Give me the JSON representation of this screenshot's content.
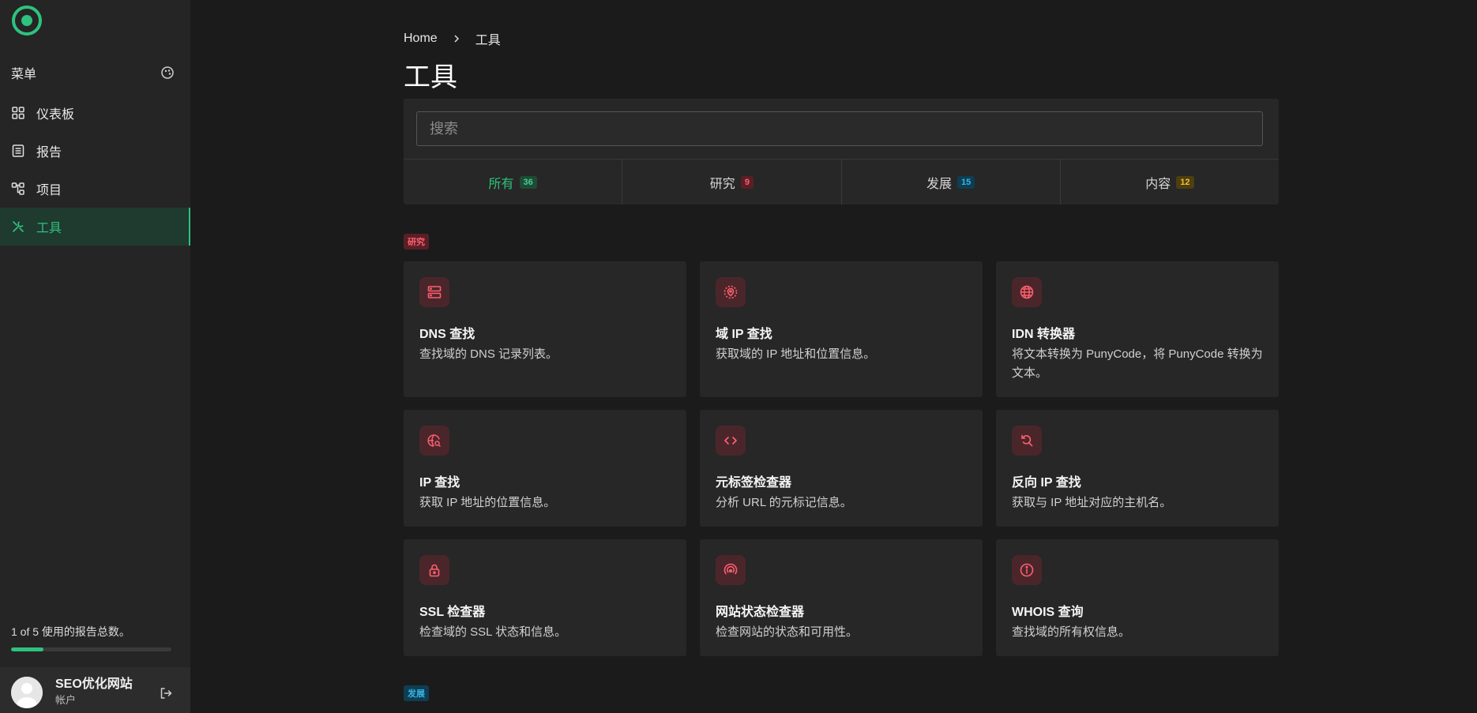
{
  "sidebar": {
    "menu_label": "菜单",
    "items": [
      {
        "label": "仪表板",
        "icon": "grid-icon"
      },
      {
        "label": "报告",
        "icon": "report-icon"
      },
      {
        "label": "项目",
        "icon": "project-icon"
      },
      {
        "label": "工具",
        "icon": "tools-icon",
        "active": true
      }
    ],
    "usage_text": "1 of 5 使用的报告总数。",
    "usage_fraction": 0.2,
    "account": {
      "name": "SEO优化网站",
      "sub": "帐户"
    }
  },
  "breadcrumb": {
    "home": "Home",
    "current": "工具"
  },
  "page_title": "工具",
  "search": {
    "placeholder": "搜索"
  },
  "tabs": [
    {
      "label": "所有",
      "count": "36"
    },
    {
      "label": "研究",
      "count": "9"
    },
    {
      "label": "发展",
      "count": "15"
    },
    {
      "label": "内容",
      "count": "12"
    }
  ],
  "sections": {
    "research": {
      "tag": "研究"
    },
    "develop": {
      "tag": "发展"
    }
  },
  "cards": [
    {
      "title": "DNS 查找",
      "desc": "查找域的 DNS 记录列表。",
      "icon": "server-icon"
    },
    {
      "title": "域 IP 查找",
      "desc": "获取域的 IP 地址和位置信息。",
      "icon": "location-pin-icon"
    },
    {
      "title": "IDN 转换器",
      "desc": "将文本转换为 PunyCode，将 PunyCode 转换为文本。",
      "icon": "globe-icon"
    },
    {
      "title": "IP 查找",
      "desc": "获取 IP 地址的位置信息。",
      "icon": "globe-search-icon"
    },
    {
      "title": "元标签检查器",
      "desc": "分析 URL 的元标记信息。",
      "icon": "code-icon"
    },
    {
      "title": "反向 IP 查找",
      "desc": "获取与 IP 地址对应的主机名。",
      "icon": "reverse-search-icon"
    },
    {
      "title": "SSL 检查器",
      "desc": "检查域的 SSL 状态和信息。",
      "icon": "lock-icon"
    },
    {
      "title": "网站状态检查器",
      "desc": "检查网站的状态和可用性。",
      "icon": "signal-icon"
    },
    {
      "title": "WHOIS 查询",
      "desc": "查找域的所有权信息。",
      "icon": "info-icon"
    }
  ],
  "colors": {
    "accent": "#2ec27e",
    "research": "#ff5f6e",
    "develop": "#35b6e8",
    "content": "#f2c230",
    "background": "#1b1b1b"
  }
}
